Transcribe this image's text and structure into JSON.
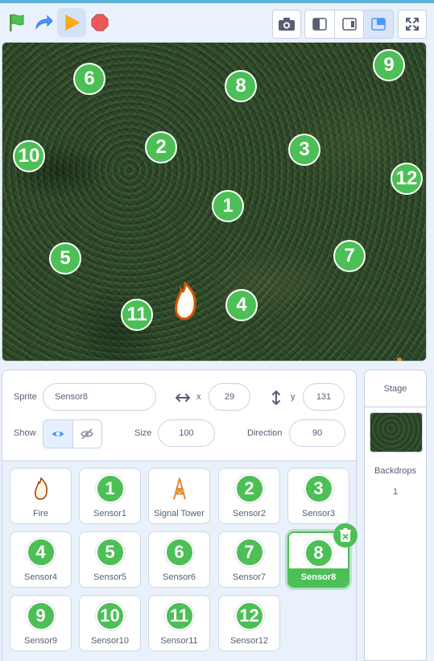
{
  "toolbar": {
    "buttons": [
      "green-flag",
      "turbo-arrow",
      "play",
      "stop"
    ],
    "camera": "camera-icon",
    "modes": [
      "small-stage-mode",
      "large-stage-mode",
      "custom-stage-mode"
    ],
    "fullscreen": "fullscreen-icon"
  },
  "stage": {
    "sensors": [
      "1",
      "2",
      "3",
      "4",
      "5",
      "6",
      "7",
      "8",
      "9",
      "10",
      "11",
      "12"
    ]
  },
  "sprite_info": {
    "sprite_label": "Sprite",
    "sprite_name": "Sensor8",
    "x_label": "x",
    "x_value": "29",
    "y_label": "y",
    "y_value": "131",
    "show_label": "Show",
    "size_label": "Size",
    "size_value": "100",
    "direction_label": "Direction",
    "direction_value": "90"
  },
  "sprites": [
    {
      "name": "Fire",
      "badge": ""
    },
    {
      "name": "Sensor1",
      "badge": "1"
    },
    {
      "name": "Signal Tower",
      "badge": ""
    },
    {
      "name": "Sensor2",
      "badge": "2"
    },
    {
      "name": "Sensor3",
      "badge": "3"
    },
    {
      "name": "Sensor4",
      "badge": "4"
    },
    {
      "name": "Sensor5",
      "badge": "5"
    },
    {
      "name": "Sensor6",
      "badge": "6"
    },
    {
      "name": "Sensor7",
      "badge": "7"
    },
    {
      "name": "Sensor8",
      "badge": "8"
    },
    {
      "name": "Sensor9",
      "badge": "9"
    },
    {
      "name": "Sensor10",
      "badge": "10"
    },
    {
      "name": "Sensor11",
      "badge": "11"
    },
    {
      "name": "Sensor12",
      "badge": "12"
    }
  ],
  "stage_panel": {
    "title": "Stage",
    "backdrops_label": "Backdrops",
    "backdrops_count": "1"
  },
  "colors": {
    "accent": "#4cbf56",
    "ui_blue": "#4c97ff",
    "background": "#e9f1fc"
  }
}
